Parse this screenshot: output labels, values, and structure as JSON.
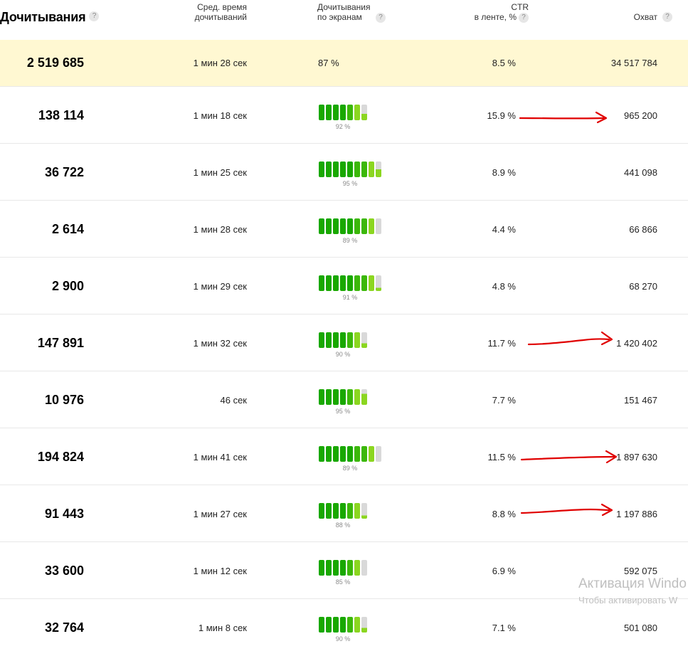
{
  "header": {
    "reads_title": "Дочитывания",
    "avg_time_line1": "Сред. время",
    "avg_time_line2": "дочитываний",
    "screens_line1": "Дочитывания",
    "screens_line2": "по экранам",
    "ctr_line1": "CTR",
    "ctr_line2": "в ленте, %",
    "reach_title": "Охват",
    "help_glyph": "?"
  },
  "total": {
    "reads": "2 519 685",
    "avg_time": "1 мин 28 сек",
    "screens_pct": "87 %",
    "ctr": "8.5 %",
    "reach": "34 517 784"
  },
  "rows": [
    {
      "reads": "138 114",
      "avg_time": "1 мин 18 сек",
      "bar_pct": "92 %",
      "fraction": 0.92,
      "bars": 7,
      "ctr": "15.9 %",
      "reach": "965 200"
    },
    {
      "reads": "36 722",
      "avg_time": "1 мин 25 сек",
      "bar_pct": "95 %",
      "fraction": 0.95,
      "bars": 9,
      "ctr": "8.9 %",
      "reach": "441 098"
    },
    {
      "reads": "2 614",
      "avg_time": "1 мин 28 сек",
      "bar_pct": "89 %",
      "fraction": 0.89,
      "bars": 9,
      "ctr": "4.4 %",
      "reach": "66 866"
    },
    {
      "reads": "2 900",
      "avg_time": "1 мин 29 сек",
      "bar_pct": "91 %",
      "fraction": 0.91,
      "bars": 9,
      "ctr": "4.8 %",
      "reach": "68 270"
    },
    {
      "reads": "147 891",
      "avg_time": "1 мин 32 сек",
      "bar_pct": "90 %",
      "fraction": 0.9,
      "bars": 7,
      "ctr": "11.7 %",
      "reach": "1 420 402"
    },
    {
      "reads": "10 976",
      "avg_time": "46 сек",
      "bar_pct": "95 %",
      "fraction": 0.95,
      "bars": 7,
      "ctr": "7.7 %",
      "reach": "151 467"
    },
    {
      "reads": "194 824",
      "avg_time": "1 мин 41 сек",
      "bar_pct": "89 %",
      "fraction": 0.89,
      "bars": 9,
      "ctr": "11.5 %",
      "reach": "1 897 630"
    },
    {
      "reads": "91 443",
      "avg_time": "1 мин 27 сек",
      "bar_pct": "88 %",
      "fraction": 0.88,
      "bars": 7,
      "ctr": "8.8 %",
      "reach": "1 197 886"
    },
    {
      "reads": "33 600",
      "avg_time": "1 мин 12 сек",
      "bar_pct": "85 %",
      "fraction": 0.85,
      "bars": 7,
      "ctr": "6.9 %",
      "reach": "592 075"
    },
    {
      "reads": "32 764",
      "avg_time": "1 мин 8 сек",
      "bar_pct": "90 %",
      "fraction": 0.9,
      "bars": 7,
      "ctr": "7.1 %",
      "reach": "501 080"
    }
  ],
  "annotations": {
    "arrow_color": "#e00000",
    "arrow_rows": [
      0,
      4,
      6,
      7
    ]
  },
  "watermark": {
    "line1": "Активация Windo",
    "line2": "Чтобы активировать W"
  },
  "colors": {
    "bar_dark": "#19a800",
    "bar_light": "#8bd620",
    "bar_empty": "#d9d9d9",
    "total_bg": "#fff8d2"
  }
}
